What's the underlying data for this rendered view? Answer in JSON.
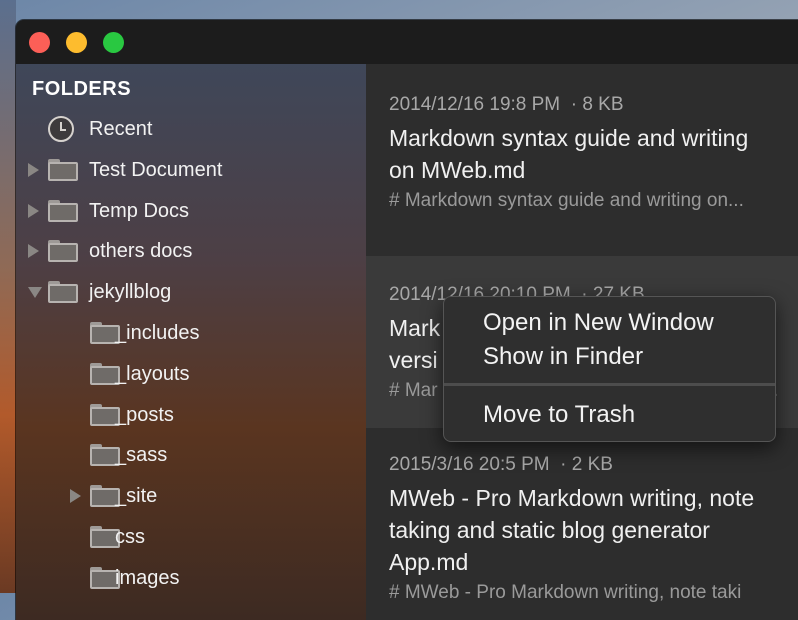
{
  "window": {
    "close_label": "close",
    "minimize_label": "minimize",
    "zoom_label": "zoom"
  },
  "sidebar": {
    "header": "FOLDERS",
    "items": [
      {
        "label": "Recent",
        "icon": "clock-icon",
        "disclosure": "none",
        "indent": 0
      },
      {
        "label": "Test Document",
        "icon": "folder-icon",
        "disclosure": "collapsed",
        "indent": 0
      },
      {
        "label": "Temp Docs",
        "icon": "folder-icon",
        "disclosure": "collapsed",
        "indent": 0
      },
      {
        "label": "others docs",
        "icon": "folder-icon",
        "disclosure": "collapsed",
        "indent": 0
      },
      {
        "label": "jekyllblog",
        "icon": "folder-icon",
        "disclosure": "expanded",
        "indent": 0
      },
      {
        "label": "_includes",
        "icon": "folder-icon",
        "disclosure": "none",
        "indent": 1
      },
      {
        "label": "_layouts",
        "icon": "folder-icon",
        "disclosure": "none",
        "indent": 1
      },
      {
        "label": "_posts",
        "icon": "folder-icon",
        "disclosure": "none",
        "indent": 1
      },
      {
        "label": "_sass",
        "icon": "folder-icon",
        "disclosure": "none",
        "indent": 1
      },
      {
        "label": "_site",
        "icon": "folder-icon",
        "disclosure": "collapsed",
        "indent": 1
      },
      {
        "label": "css",
        "icon": "folder-icon",
        "disclosure": "none",
        "indent": 1
      },
      {
        "label": "images",
        "icon": "folder-icon",
        "disclosure": "none",
        "indent": 1
      }
    ]
  },
  "notes": [
    {
      "date": "2014/12/16 19:8 PM",
      "size": "8 KB",
      "title_lines": [
        "Markdown syntax guide and writing",
        "on MWeb.md"
      ],
      "excerpt": "# Markdown syntax guide and writing on..."
    },
    {
      "date": "2014/12/16 20:10 PM",
      "size": "27 KB",
      "title_lines": [
        "Mark",
        "versi"
      ],
      "excerpt_left": "# Mar",
      "excerpt_right": "[..."
    },
    {
      "date": "2015/3/16 20:5 PM",
      "size": "2 KB",
      "title_lines": [
        "MWeb - Pro Markdown writing, note",
        "taking and static blog generator",
        "App.md"
      ],
      "excerpt": "# MWeb - Pro Markdown writing, note taki"
    }
  ],
  "meta_separator": "·",
  "context_menu": {
    "items": [
      "Open in New Window",
      "Show in Finder",
      "Move to Trash"
    ]
  }
}
